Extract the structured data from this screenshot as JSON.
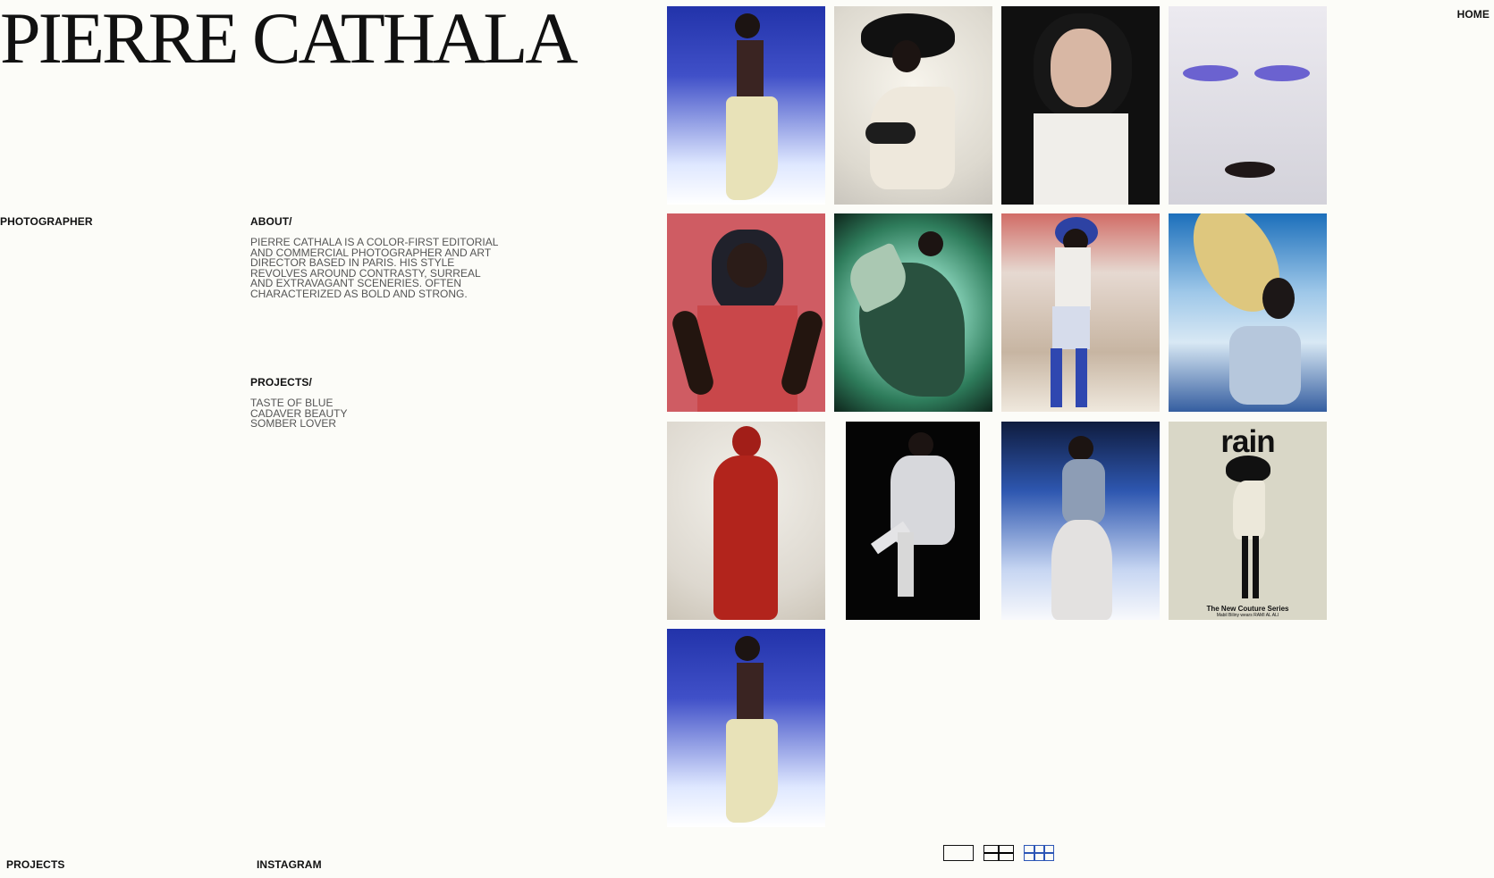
{
  "site": {
    "name": "PIERRE CATHALA",
    "role": "PHOTOGRAPHER",
    "nav_home": "HOME"
  },
  "about": {
    "title": "ABOUT/",
    "text": "PIERRE CATHALA IS A COLOR-FIRST EDITORIAL AND COMMERCIAL PHOTOGRAPHER AND ART DIRECTOR BASED IN PARIS. HIS STYLE REVOLVES AROUND CONTRASTY, SURREAL AND EXTRAVAGANT SCENERIES. OFTEN CHARACTERIZED AS BOLD AND STRONG."
  },
  "projects": {
    "title": "PROJECTS/",
    "items": [
      "TASTE OF BLUE",
      "CADAVER BEAUTY",
      "SOMBER LOVER"
    ]
  },
  "footer": {
    "projects": "PROJECTS",
    "instagram": "INSTAGRAM"
  },
  "gallery": {
    "magazine_title": "rain",
    "magazine_subtitle": "The New Couture Series",
    "magazine_caption": "Mabil Biliny wears RAMI AL ALI",
    "icons": [
      "single-view-icon",
      "two-column-view-icon",
      "grid-view-icon"
    ],
    "colors": {
      "accent": "#2d56b6",
      "background": "#fcfcf8"
    }
  }
}
